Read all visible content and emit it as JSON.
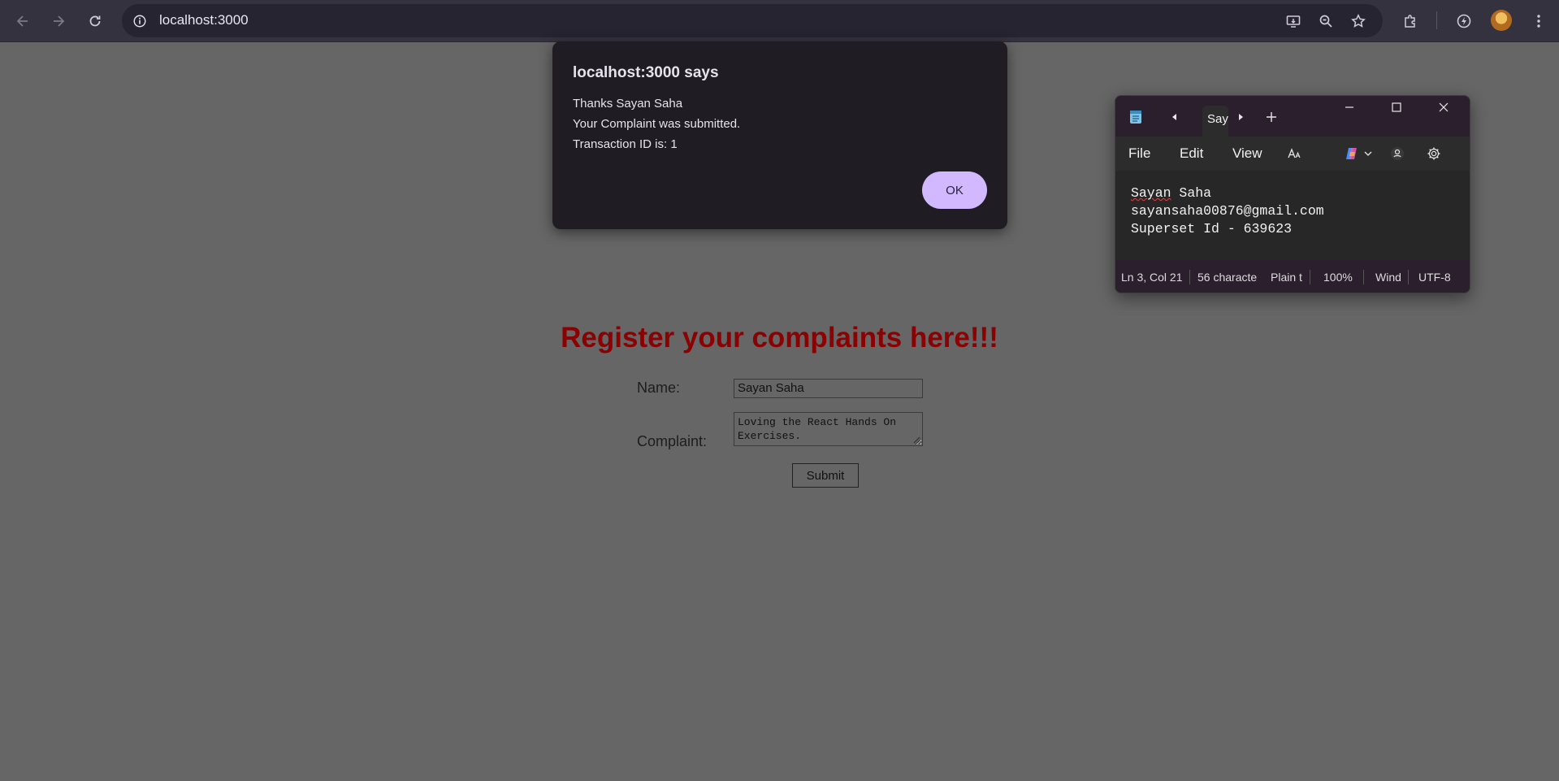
{
  "browser": {
    "url": "localhost:3000"
  },
  "page": {
    "title": "Register your complaints here!!!",
    "name_label": "Name:",
    "name_value": "Sayan Saha",
    "complaint_label": "Complaint:",
    "complaint_value": "Loving the React Hands On Exercises.",
    "submit_label": "Submit"
  },
  "dialog": {
    "title": "localhost:3000 says",
    "line1": "Thanks Sayan Saha",
    "line2": "Your Complaint was submitted.",
    "line3": "Transaction ID is: 1",
    "ok_label": "OK"
  },
  "notepad": {
    "tab_label": "Say",
    "menu": {
      "file": "File",
      "edit": "Edit",
      "view": "View"
    },
    "lines": {
      "first_word": "Sayan",
      "first_rest": " Saha",
      "line2": "sayansaha00876@gmail.com",
      "line3": "Superset Id - 639623"
    },
    "status": {
      "position": "Ln 3, Col 21",
      "chars": "56 characte",
      "format": "Plain t",
      "zoom": "100%",
      "line_ending": "Wind",
      "encoding": "UTF-8"
    }
  },
  "colors": {
    "page_bg": "#666666",
    "title": "#8b0000",
    "ok_button": "#d2b8ff",
    "dialog_bg": "#1f1d23"
  }
}
